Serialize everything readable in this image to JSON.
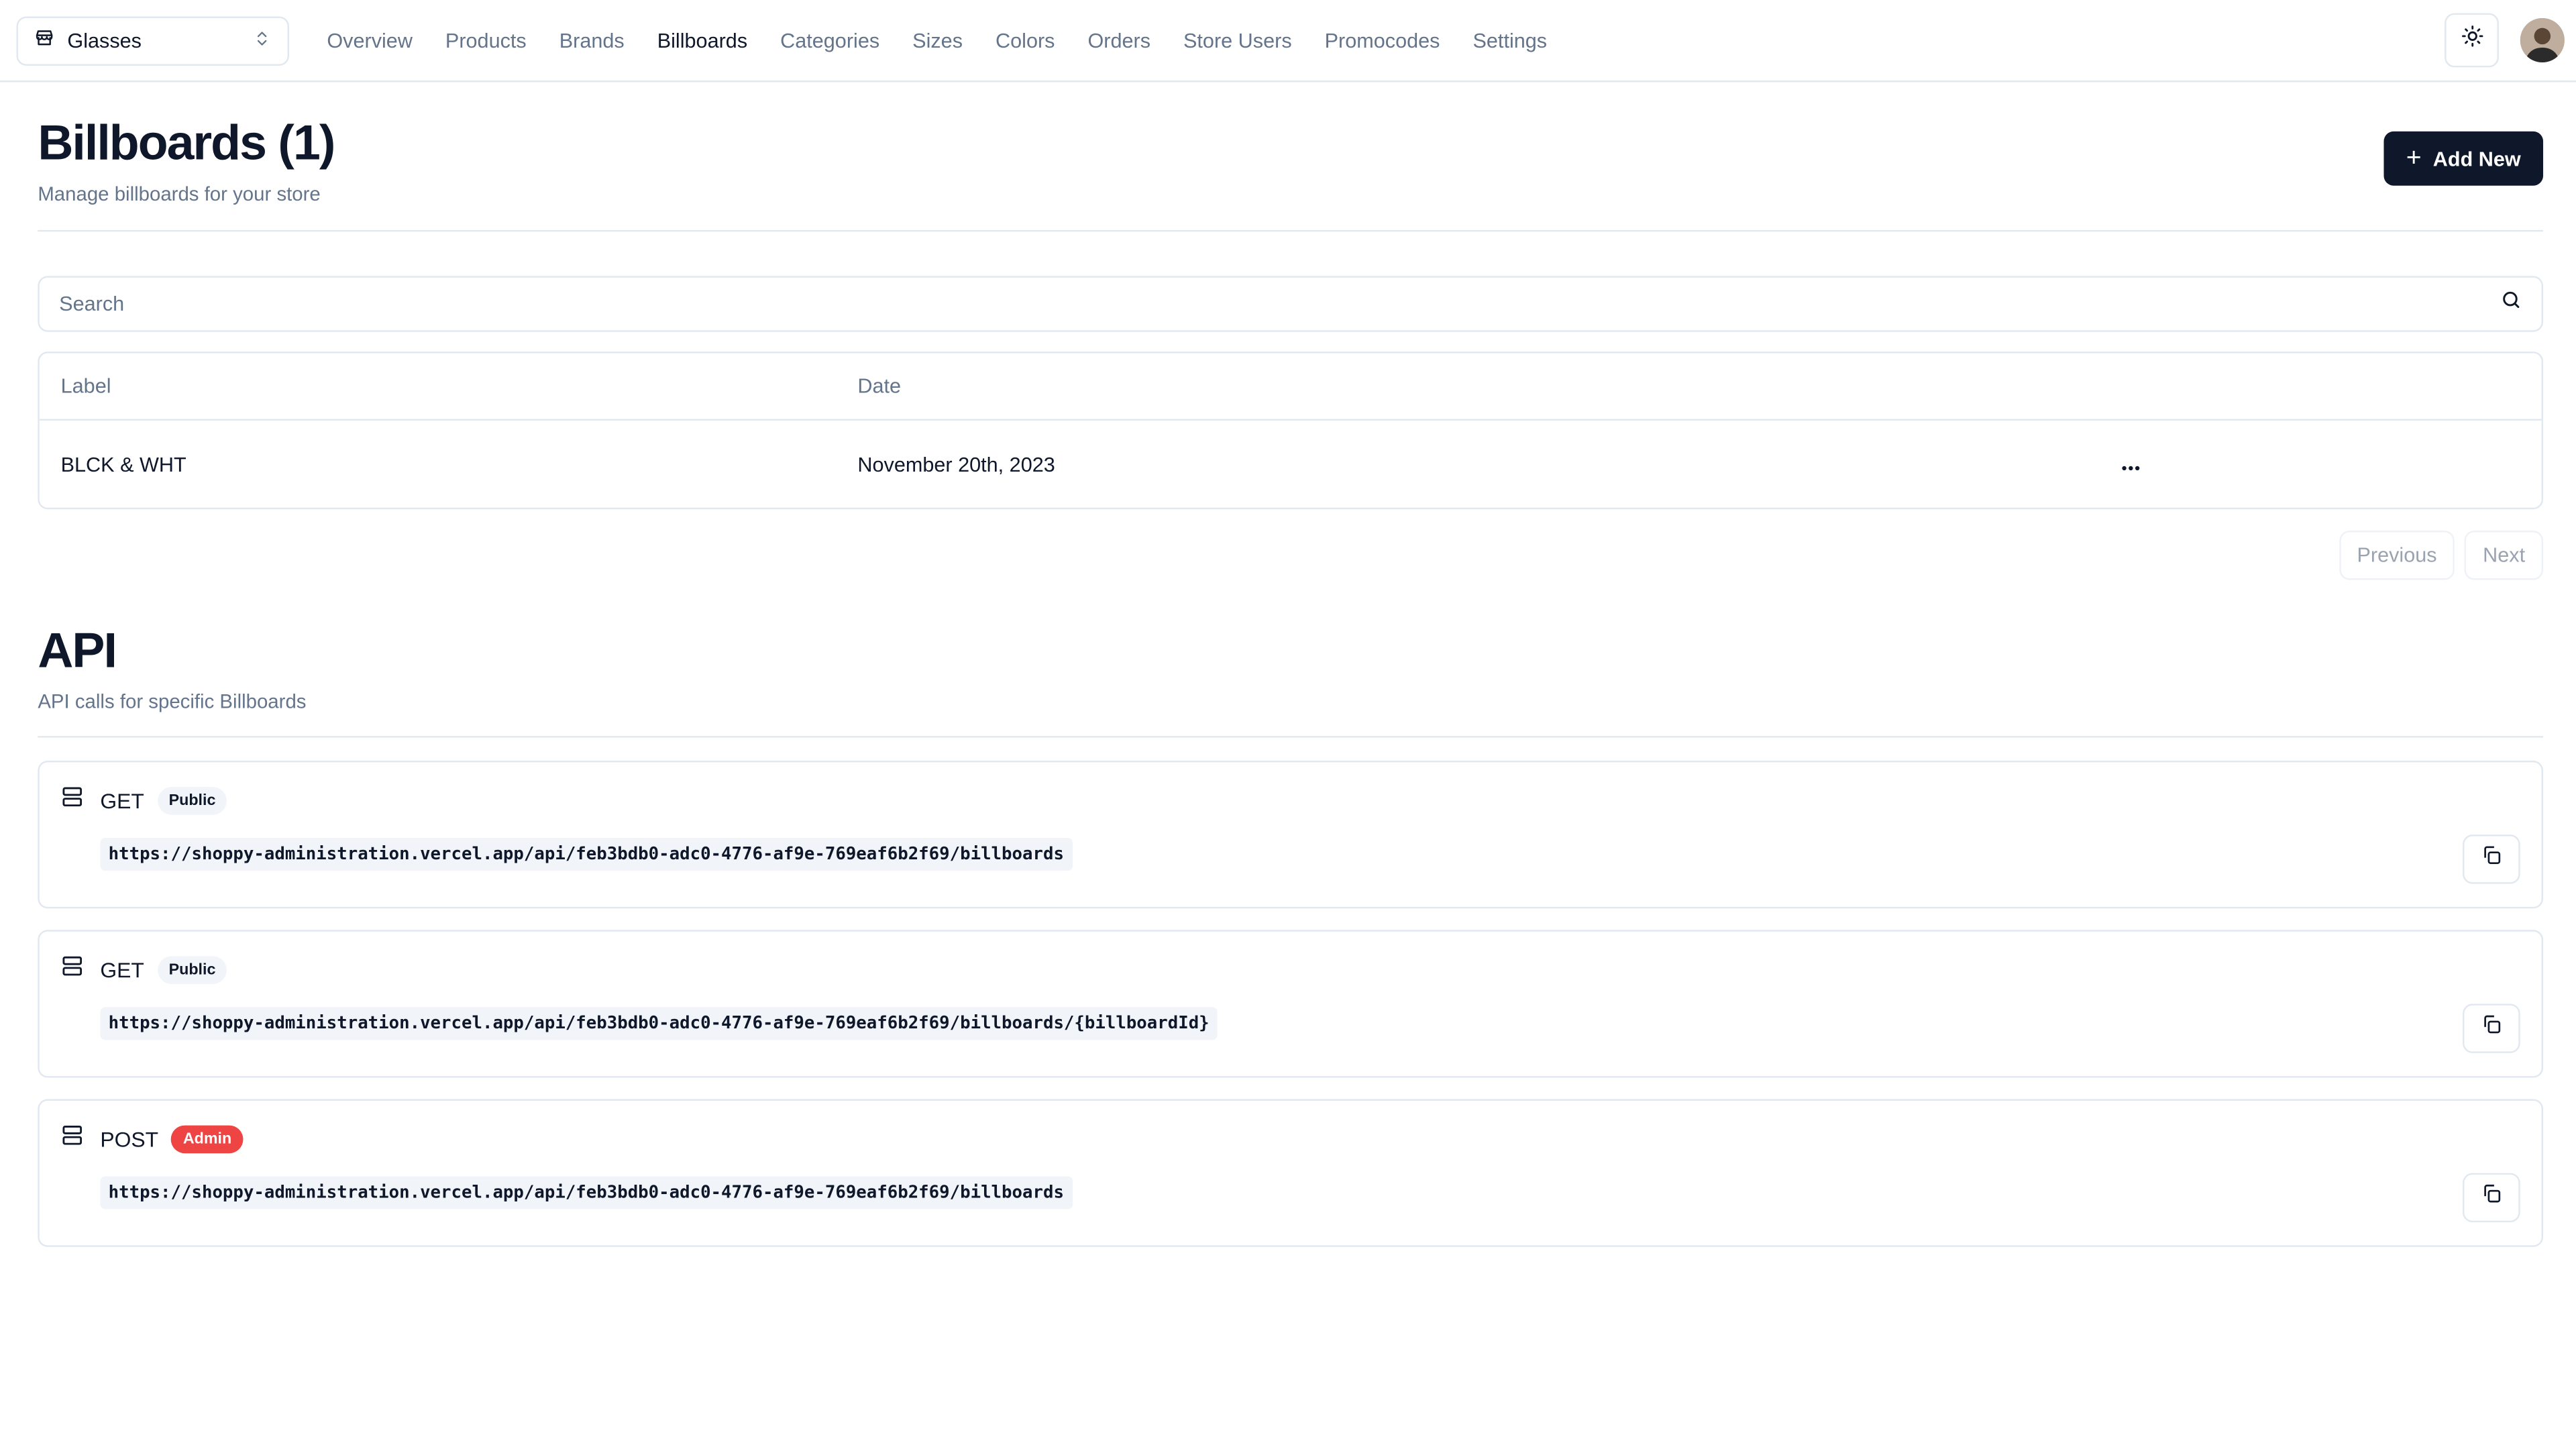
{
  "store_switcher": {
    "name": "Glasses",
    "icon": "store-icon",
    "chevron": "chevrons-up-down-icon"
  },
  "nav": {
    "items": [
      {
        "label": "Overview",
        "active": false
      },
      {
        "label": "Products",
        "active": false
      },
      {
        "label": "Brands",
        "active": false
      },
      {
        "label": "Billboards",
        "active": true
      },
      {
        "label": "Categories",
        "active": false
      },
      {
        "label": "Sizes",
        "active": false
      },
      {
        "label": "Colors",
        "active": false
      },
      {
        "label": "Orders",
        "active": false
      },
      {
        "label": "Store Users",
        "active": false
      },
      {
        "label": "Promocodes",
        "active": false
      },
      {
        "label": "Settings",
        "active": false
      }
    ]
  },
  "header": {
    "theme_icon": "sun-icon",
    "avatar": "user-avatar"
  },
  "page": {
    "title": "Billboards (1)",
    "description": "Manage billboards for your store",
    "add_button": "Add New"
  },
  "search": {
    "placeholder": "Search",
    "value": ""
  },
  "table": {
    "columns": [
      "Label",
      "Date"
    ],
    "rows": [
      {
        "label": "BLCK & WHT",
        "date": "November 20th, 2023",
        "actions": "..."
      }
    ]
  },
  "pagination": {
    "previous": "Previous",
    "next": "Next"
  },
  "api": {
    "title": "API",
    "description": "API calls for specific Billboards",
    "endpoints": [
      {
        "method": "GET",
        "badge": "Public",
        "url": "https://shoppy-administration.vercel.app/api/feb3bdb0-adc0-4776-af9e-769eaf6b2f69/billboards"
      },
      {
        "method": "GET",
        "badge": "Public",
        "url": "https://shoppy-administration.vercel.app/api/feb3bdb0-adc0-4776-af9e-769eaf6b2f69/billboards/{billboardId}"
      },
      {
        "method": "POST",
        "badge": "Admin",
        "url": "https://shoppy-administration.vercel.app/api/feb3bdb0-adc0-4776-af9e-769eaf6b2f69/billboards"
      }
    ]
  },
  "colors": {
    "primary": "#0f172a",
    "muted": "#64748b",
    "border": "#e2e8f0",
    "admin_badge": "#ef4444",
    "code_bg": "#f1f5f9"
  }
}
